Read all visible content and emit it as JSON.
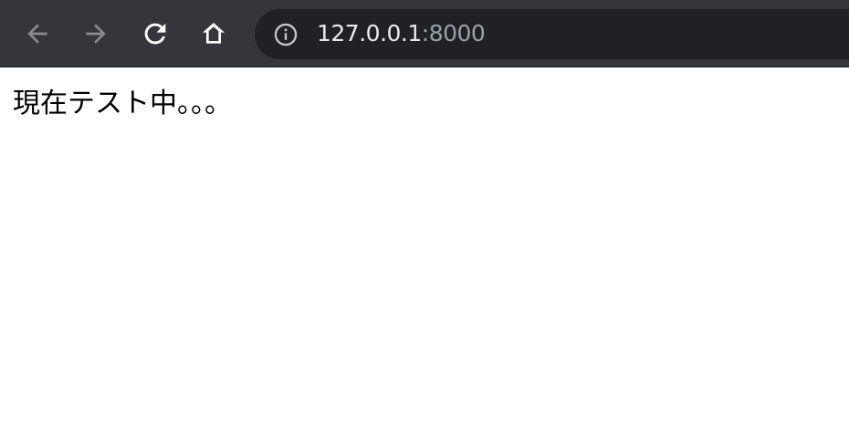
{
  "browser": {
    "address_bar": {
      "host": "127.0.0.1",
      "port": ":8000"
    },
    "icons": {
      "back": "back-arrow-icon",
      "forward": "forward-arrow-icon",
      "reload": "reload-icon",
      "home": "home-icon",
      "info": "info-icon"
    },
    "colors": {
      "toolbar": "#35363a",
      "omnibox": "#202124",
      "active_icon": "#ffffff",
      "disabled_icon": "#8a8b8e",
      "port_text": "#9aa0a6"
    }
  },
  "page": {
    "text": "現在テスト中。。。"
  }
}
